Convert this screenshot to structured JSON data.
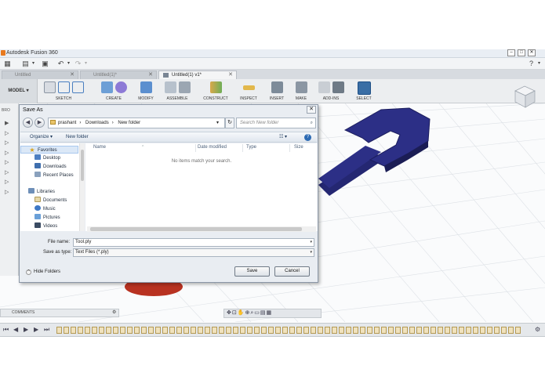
{
  "app": {
    "title": "Autodesk Fusion 360",
    "help_label": "?"
  },
  "tabs": [
    {
      "label": "Untitled"
    },
    {
      "label": "Untitled(1)*"
    },
    {
      "label": "Untitled(1) v1*"
    }
  ],
  "ribbon": {
    "workspace": "MODEL",
    "groups": [
      "SKETCH",
      "CREATE",
      "MODIFY",
      "ASSEMBLE",
      "CONSTRUCT",
      "INSPECT",
      "INSERT",
      "MAKE",
      "ADD-INS",
      "SELECT"
    ]
  },
  "browser_label": "BRO",
  "dialog": {
    "title": "Save As",
    "close_label": "✕",
    "address": {
      "parts": [
        "prashant",
        "Downloads",
        "New folder"
      ]
    },
    "search_placeholder": "Search New folder",
    "toolbar": {
      "organize": "Organize",
      "new_folder": "New folder"
    },
    "nav_pane": {
      "favorites_label": "Favorites",
      "favorites": [
        "Desktop",
        "Downloads",
        "Recent Places"
      ],
      "libraries_label": "Libraries",
      "libraries": [
        "Documents",
        "Music",
        "Pictures",
        "Videos"
      ]
    },
    "columns": [
      "Name",
      "Date modified",
      "Type",
      "Size"
    ],
    "empty_message": "No items match your search.",
    "file_name_label": "File name:",
    "file_name_value": "Tool.ply",
    "save_type_label": "Save as type:",
    "save_type_value": "Text Files (*.ply)",
    "hide_folders": "Hide Folders",
    "save_button": "Save",
    "cancel_button": "Cancel"
  },
  "comments_label": "COMMENTS",
  "colors": {
    "wrench": "#2c2f86",
    "red_body": "#b83221",
    "accent": "#3a6ea5"
  }
}
